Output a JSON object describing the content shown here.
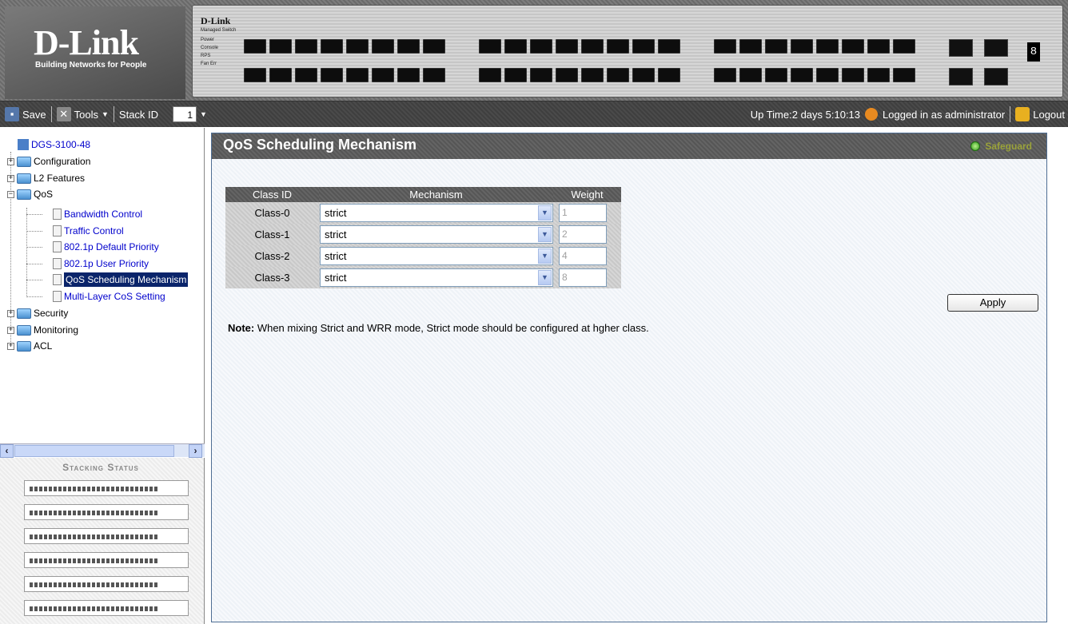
{
  "banner": {
    "brand": "D-Link",
    "tagline": "Building Networks for People",
    "panel_brand": "D-Link",
    "panel_model": "Managed Switch",
    "leds": [
      "Power",
      "Console",
      "RPS",
      "Fan Err"
    ],
    "unit_id": "8"
  },
  "toolbar": {
    "save_label": "Save",
    "tools_label": "Tools",
    "stack_id_label": "Stack ID",
    "stack_id_value": "1",
    "uptime": "Up Time:2 days 5:10:13",
    "logged_in": "Logged in as administrator",
    "logout_label": "Logout"
  },
  "tree": {
    "root": "DGS-3100-48",
    "configuration": "Configuration",
    "l2_features": "L2 Features",
    "qos": "QoS",
    "qos_children": [
      "Bandwidth Control",
      "Traffic Control",
      "802.1p Default Priority",
      "802.1p User Priority",
      "QoS Scheduling Mechanism",
      "Multi-Layer CoS Setting"
    ],
    "security": "Security",
    "monitoring": "Monitoring",
    "acl": "ACL"
  },
  "stacking": {
    "title": "Stacking Status",
    "unit_count": 6
  },
  "page": {
    "title": "QoS Scheduling Mechanism",
    "safeguard": "Safeguard",
    "table": {
      "headers": [
        "Class ID",
        "Mechanism",
        "Weight"
      ],
      "rows": [
        {
          "class": "Class-0",
          "mechanism": "strict",
          "weight": "1"
        },
        {
          "class": "Class-1",
          "mechanism": "strict",
          "weight": "2"
        },
        {
          "class": "Class-2",
          "mechanism": "strict",
          "weight": "4"
        },
        {
          "class": "Class-3",
          "mechanism": "strict",
          "weight": "8"
        }
      ]
    },
    "apply_label": "Apply",
    "note_label": "Note:",
    "note_text": " When mixing Strict and WRR mode, Strict mode should be configured at hgher class."
  },
  "colors": {
    "link": "#0000cc",
    "selected": "#0a246a",
    "header_bar": "#5d5d5d",
    "content_border": "#4f6e94"
  }
}
